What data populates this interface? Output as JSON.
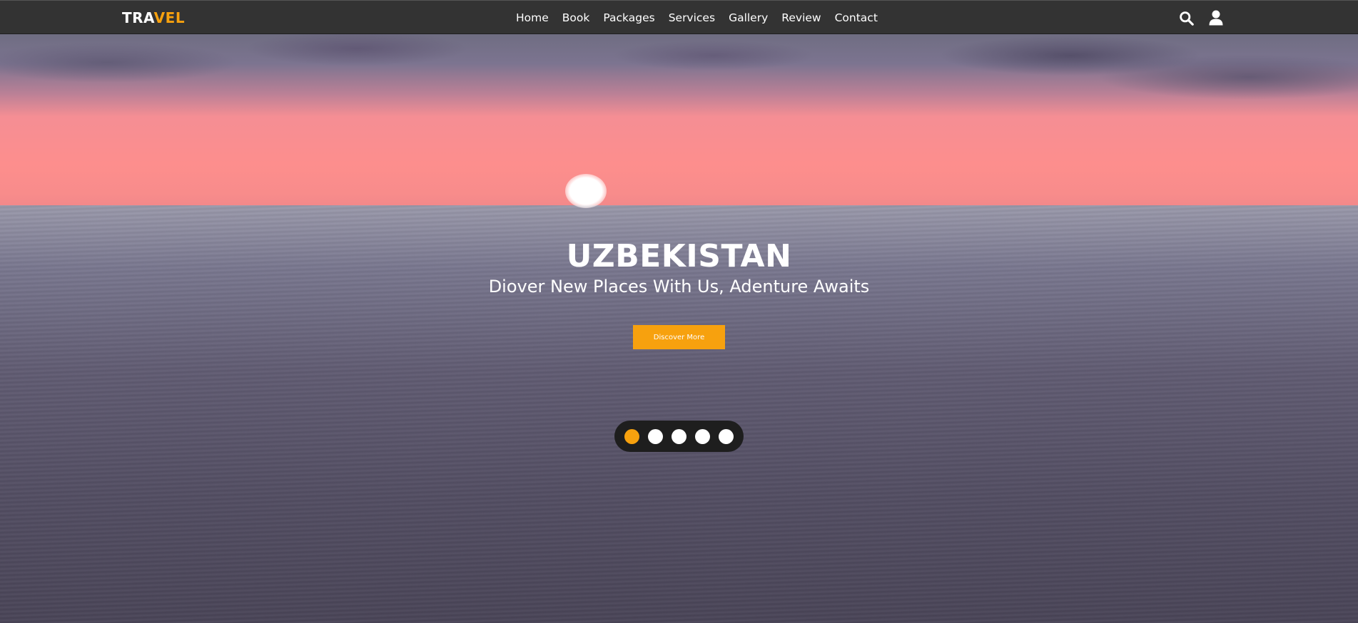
{
  "brand": {
    "logo_part1": "TRA",
    "logo_part2": "VEL",
    "accent_color": "#f7a10e"
  },
  "nav": {
    "items": [
      "Home",
      "Book",
      "Packages",
      "Services",
      "Gallery",
      "Review",
      "Contact"
    ]
  },
  "header_icons": [
    "search-icon",
    "user-icon"
  ],
  "hero": {
    "title": "UZBEKISTAN",
    "subtitle": "Diover New Places With Us, Adenture Awaits",
    "cta_label": "Discover More",
    "slider": {
      "count": 5,
      "active_index": 0
    }
  }
}
